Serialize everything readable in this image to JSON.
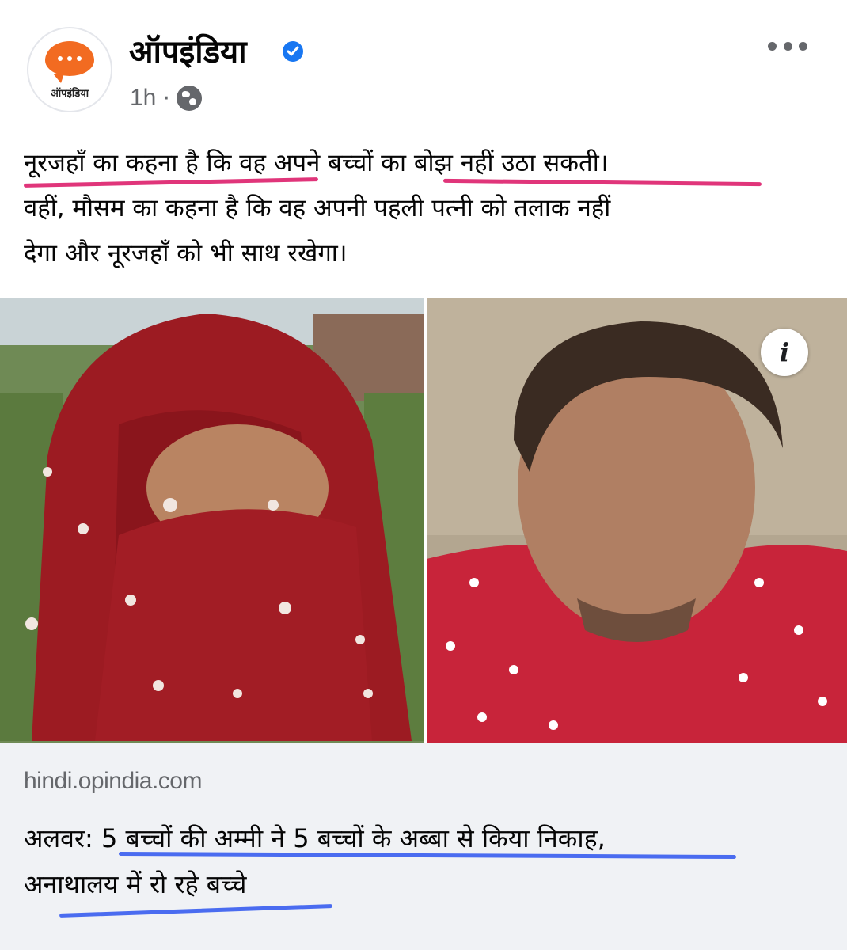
{
  "post": {
    "page_name": "ऑपइंडिया",
    "avatar_text": "ऑपइंडिया",
    "time": "1h",
    "separator": "·",
    "text_lines": [
      "नूरजहाँ का कहना है कि वह अपने बच्चों का बोझ नहीं उठा सकती।",
      "वहीं, मौसम का कहना है कि वह अपनी पहली पत्नी को तलाक नहीं",
      "देगा और नूरजहाँ को भी साथ रखेगा।"
    ]
  },
  "icons": {
    "verified": "verified-badge-icon",
    "audience": "globe-icon",
    "more": "more-options-icon",
    "info": "info-icon",
    "info_glyph": "i"
  },
  "colors": {
    "highlight_pink": "#e0357a",
    "highlight_blue": "#4a6cf0",
    "brand_orange": "#f26b21",
    "verified_blue": "#1877f2"
  },
  "link_preview": {
    "domain": "hindi.opindia.com",
    "title_lines": [
      "अलवर: 5 बच्चों की अम्मी ने 5 बच्चों के अब्बा से किया निकाह,",
      "अनाथालय में रो रहे बच्चे"
    ]
  }
}
